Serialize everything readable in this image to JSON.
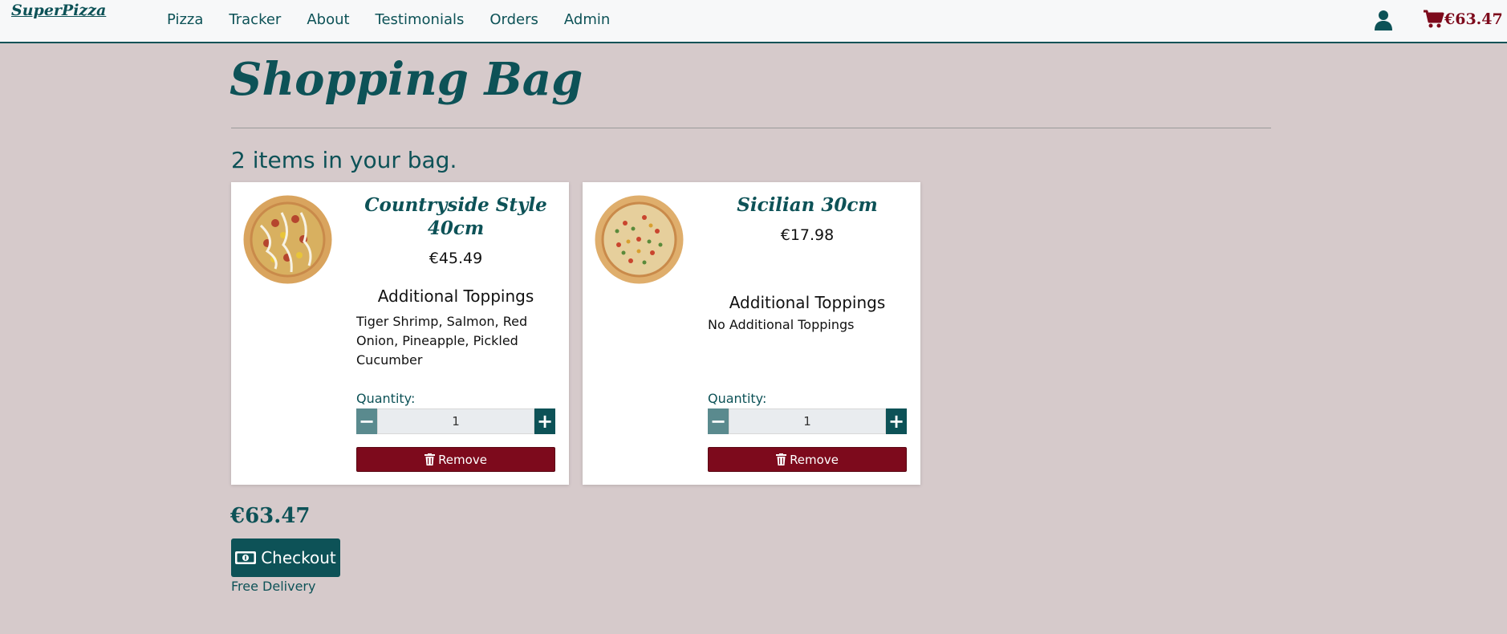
{
  "navbar": {
    "brand": "SuperPizza",
    "links": [
      "Pizza",
      "Tracker",
      "About",
      "Testimonials",
      "Orders",
      "Admin"
    ],
    "cart_total": "€63.47"
  },
  "page": {
    "title": "Shopping Bag",
    "items_count": "2 items in your bag."
  },
  "items": [
    {
      "name": "Countryside Style 40cm",
      "price": "€45.49",
      "toppings_title": "Additional Toppings",
      "toppings": "Tiger Shrimp, Salmon, Red Onion, Pineapple, Pickled Cucumber",
      "quantity_label": "Quantity:",
      "quantity": "1",
      "remove_label": "Remove"
    },
    {
      "name": "Sicilian 30cm",
      "price": "€17.98",
      "toppings_title": "Additional Toppings",
      "toppings": "No Additional Toppings",
      "quantity_label": "Quantity:",
      "quantity": "1",
      "remove_label": "Remove"
    }
  ],
  "summary": {
    "total": "€63.47",
    "checkout_label": "Checkout",
    "delivery_note": "Free Delivery"
  },
  "colors": {
    "primary": "#0d5257",
    "accent": "#7d0a1c",
    "background": "#d6cacb"
  }
}
